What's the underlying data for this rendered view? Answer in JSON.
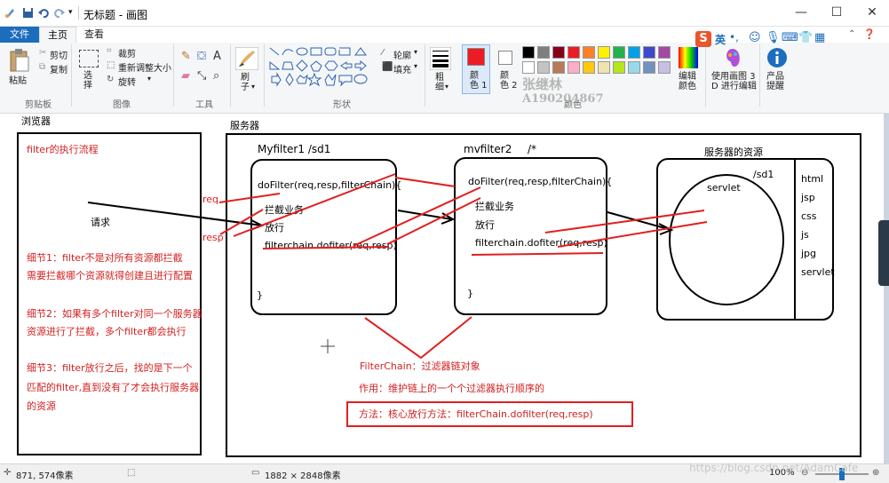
{
  "window": {
    "title": "无标题 - 画图"
  },
  "menu": {
    "file": "文件",
    "home": "主页",
    "view": "查看"
  },
  "ribbon": {
    "clipboard": {
      "paste": "粘贴",
      "cut": "剪切",
      "copy": "复制",
      "group": "剪贴板"
    },
    "image": {
      "select": "选\n择",
      "crop": "裁剪",
      "resize": "重新调整大小",
      "rotate": "旋转",
      "group": "图像"
    },
    "tools": {
      "group": "工具"
    },
    "brushes": {
      "label": "刷\n子"
    },
    "shapes": {
      "outline": "轮廓",
      "fill": "填充",
      "group": "形状"
    },
    "size": {
      "label": "粗\n细"
    },
    "color1": {
      "label": "颜\n色 1",
      "value": "#ed1c24"
    },
    "color2": {
      "label": "颜\n色 2",
      "value": "#ffffff"
    },
    "colors_group": "颜色",
    "edit_colors": "编辑\n颜色",
    "paint3d": "使用画图 3\nD 进行编辑",
    "product_alert": "产品\n提醒",
    "watermark_name": "张继林",
    "watermark_id": "A190204867"
  },
  "palette": [
    "#000000",
    "#7f7f7f",
    "#880015",
    "#ed1c24",
    "#ff7f27",
    "#fff200",
    "#22b14c",
    "#00a2e8",
    "#3f48cc",
    "#a349a4",
    "#ffffff",
    "#c3c3c3",
    "#b97a57",
    "#ffaec9",
    "#ffc90e",
    "#efe4b0",
    "#b5e61d",
    "#99d9ea",
    "#7092be",
    "#c8bfe7"
  ],
  "ime": {
    "label": "英"
  },
  "canvas": {
    "browser_title": "浏览器",
    "server_title": "服务器",
    "flow_title": "filter的执行流程",
    "request": "请求",
    "req": "req",
    "resp": "resp",
    "detail1_a": "细节1：filter不是对所有资源都拦截",
    "detail1_b": "需要拦截哪个资源就得创建且进行配置",
    "detail2_a": "细节2：如果有多个filter对同一个服务器",
    "detail2_b": "资源进行了拦截，多个filter都会执行",
    "detail3_a": "细节3：filter放行之后，找的是下一个",
    "detail3_b": "匹配的filter,直到没有了才会执行服务器",
    "detail3_c": "的资源",
    "f1_title": "Myfilter1  /sd1",
    "f2_title": "mvfilter2",
    "f2_path": "/*",
    "dofilter": "doFilter(req,resp,filterChain){",
    "intercept": "拦截业务",
    "release": "放行",
    "chain_call": "filterchain.dofiter(req,resp)",
    "close_brace": "}",
    "res_title": "服务器的资源",
    "servlet": "servlet",
    "sd1": "/sd1",
    "res_list": [
      "html",
      "jsp",
      "css",
      "js",
      "jpg",
      "servlet"
    ],
    "fc_title": "FilterChain：过滤器链对象",
    "fc_role": "作用：维护链上的一个个过滤器执行顺序的",
    "fc_method": "方法：核心放行方法：filterChain.dofilter(req,resp)"
  },
  "status": {
    "cursor": "871, 574像素",
    "size": "1882 × 2848像素",
    "zoom": "100%"
  },
  "overlay_watermark": "https://blog.csdn.net/AdamCafe"
}
